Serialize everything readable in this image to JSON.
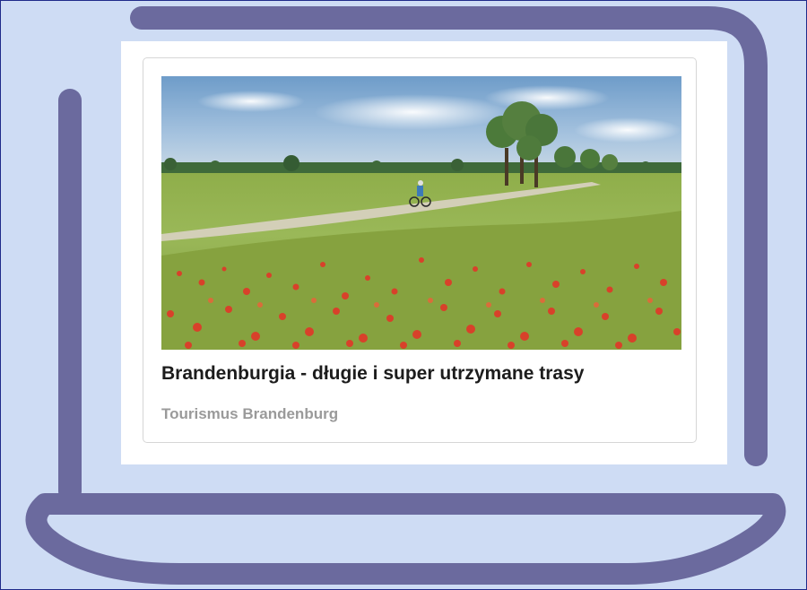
{
  "card": {
    "title": "Brandenburgia - długie i super utrzymane trasy",
    "source": "Tourismus Brandenburg",
    "image_alt": "poppy-field-cyclist-photo"
  },
  "colors": {
    "background": "#cedcf4",
    "laptop_outline": "#6b6a9e",
    "frame_border": "#1f2a8a",
    "title_text": "#1c1c1c",
    "source_text": "#9a9a9a"
  }
}
